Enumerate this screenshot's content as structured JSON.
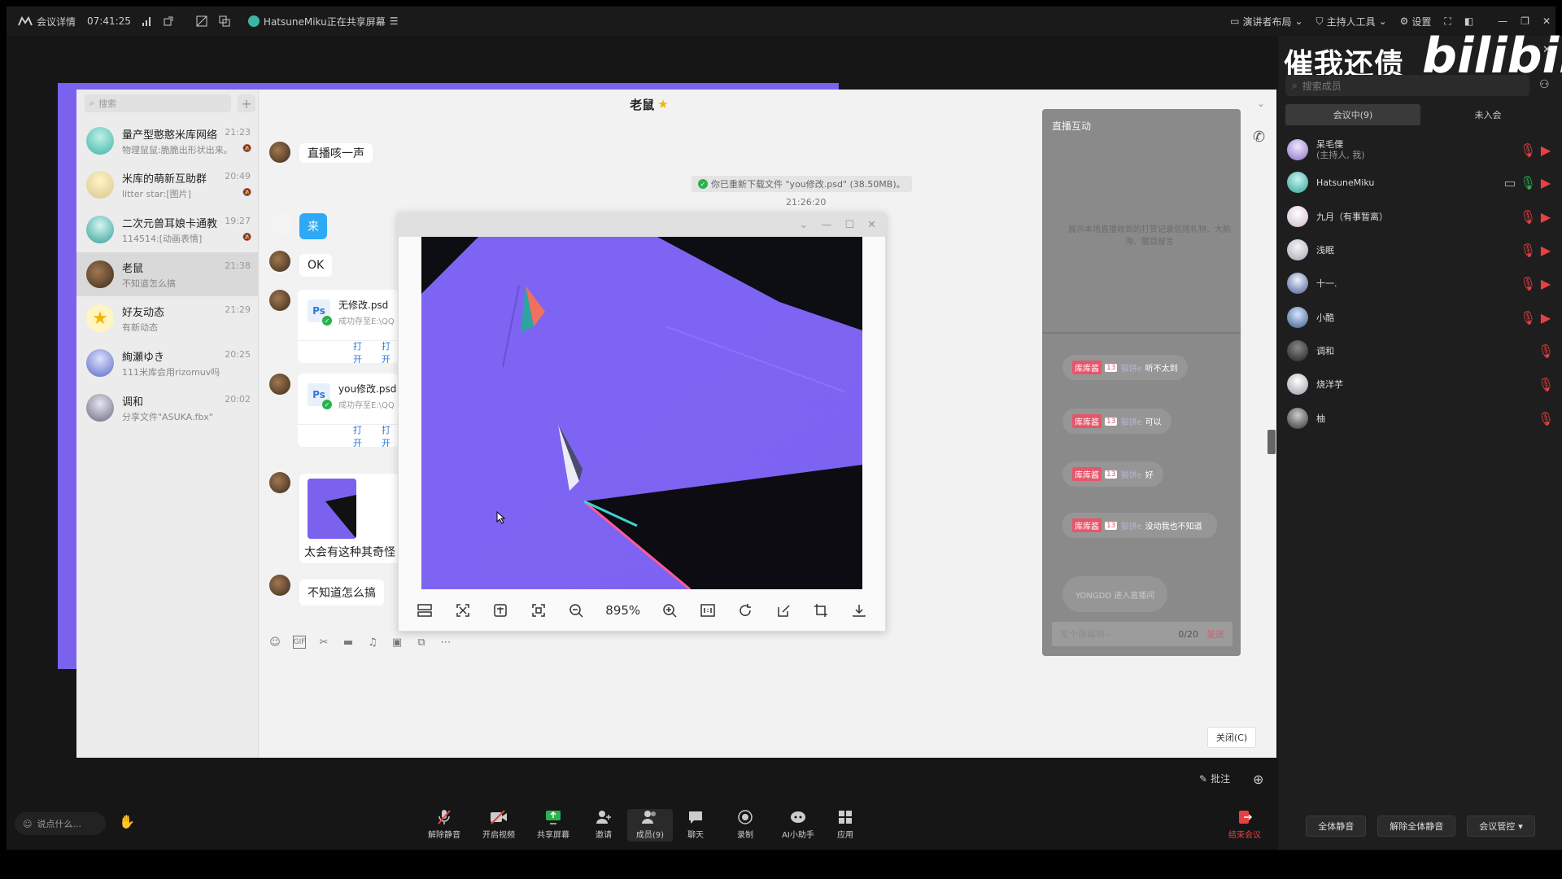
{
  "topbar": {
    "meeting_details": "会议详情",
    "time": "07:41:25",
    "sharing": "HatsuneMiku正在共享屏幕",
    "speaker_layout": "演讲者布局",
    "host_tools": "主持人工具",
    "settings": "设置"
  },
  "watermark": {
    "text": "催我还债",
    "logo": "bilibili"
  },
  "qq": {
    "search_placeholder": "搜索",
    "chats": [
      {
        "name": "量产型憨憨米库网络",
        "preview": "物理鼠鼠:脆脆出形状出来。",
        "time": "21:23"
      },
      {
        "name": "米库的萌新互助群",
        "preview": "litter star:[图片]",
        "time": "20:49"
      },
      {
        "name": "二次元兽耳娘卡通教",
        "preview": "114514:[动画表情]",
        "time": "19:27"
      },
      {
        "name": "老鼠",
        "preview": "不知道怎么搞",
        "time": "21:38"
      },
      {
        "name": "好友动态",
        "preview": "有新动态",
        "time": "21:29"
      },
      {
        "name": "絢瀬ゆき",
        "preview": "111米库会用rizomuv吗",
        "time": "20:25"
      },
      {
        "name": "调和",
        "preview": "分享文件\"ASUKA.fbx\"",
        "time": "20:02"
      }
    ],
    "chat_title": "老鼠",
    "messages": {
      "m1": "直播咳一声",
      "sys_notice": "你已重新下载文件 \"you修改.psd\" (38.50MB)。",
      "sys_time": "21:26:20",
      "m2": "来",
      "m3": "OK",
      "file1_name": "无修改.psd",
      "file1_status": "成功存至E:\\QQ",
      "file2_name": "you修改.psd",
      "file2_status": "成功存至E:\\QQ",
      "open": "打开",
      "open_folder": "打开",
      "m4": "太会有这种其奇怪",
      "m5": "不知道怎么搞"
    },
    "close_button": "关闭(C)"
  },
  "viewer": {
    "zoom": "895%"
  },
  "live": {
    "title": "直播互动",
    "hint": "展示本场直播收到的打赏记录包括礼物、大航海、醒目留言",
    "messages": [
      {
        "tag": "库库酱",
        "level": "13",
        "user": "猫饼e",
        "text": "听不太到"
      },
      {
        "tag": "库库酱",
        "level": "13",
        "user": "猫饼e",
        "text": "可以"
      },
      {
        "tag": "库库酱",
        "level": "13",
        "user": "猫饼e",
        "text": "好"
      },
      {
        "tag": "库库酱",
        "level": "13",
        "user": "猫饼e",
        "text": "没动我也不知道"
      }
    ],
    "enter_notice": "YONGDD 进入直播间",
    "input_placeholder": "发个弹幕呗~",
    "counter": "0/20",
    "send": "发送"
  },
  "members": {
    "search_placeholder": "搜索成员",
    "tab_in": "会议中(9)",
    "tab_not": "未入会",
    "list": [
      {
        "name": "呆毛傈",
        "sub": "(主持人, 我)"
      },
      {
        "name": "HatsuneMiku",
        "sub": ""
      },
      {
        "name": "九月（有事暂离）",
        "sub": ""
      },
      {
        "name": "浅眠",
        "sub": ""
      },
      {
        "name": "十一.",
        "sub": ""
      },
      {
        "name": "小酷",
        "sub": ""
      },
      {
        "name": "调和",
        "sub": ""
      },
      {
        "name": "烧洋芋",
        "sub": ""
      },
      {
        "name": "柚",
        "sub": ""
      }
    ],
    "mute_all": "全体静音",
    "unmute_all": "解除全体静音",
    "control": "会议管控"
  },
  "bottombar": {
    "say_placeholder": "说点什么...",
    "annotate": "批注",
    "buttons": [
      "解除静音",
      "开启视频",
      "共享屏幕",
      "邀请",
      "成员(9)",
      "聊天",
      "录制",
      "AI小助手",
      "应用"
    ],
    "end": "结束会议"
  },
  "colors": {
    "accent_purple": "#7b62ee",
    "danger": "#e84040",
    "live_tag": "#e5566b"
  }
}
